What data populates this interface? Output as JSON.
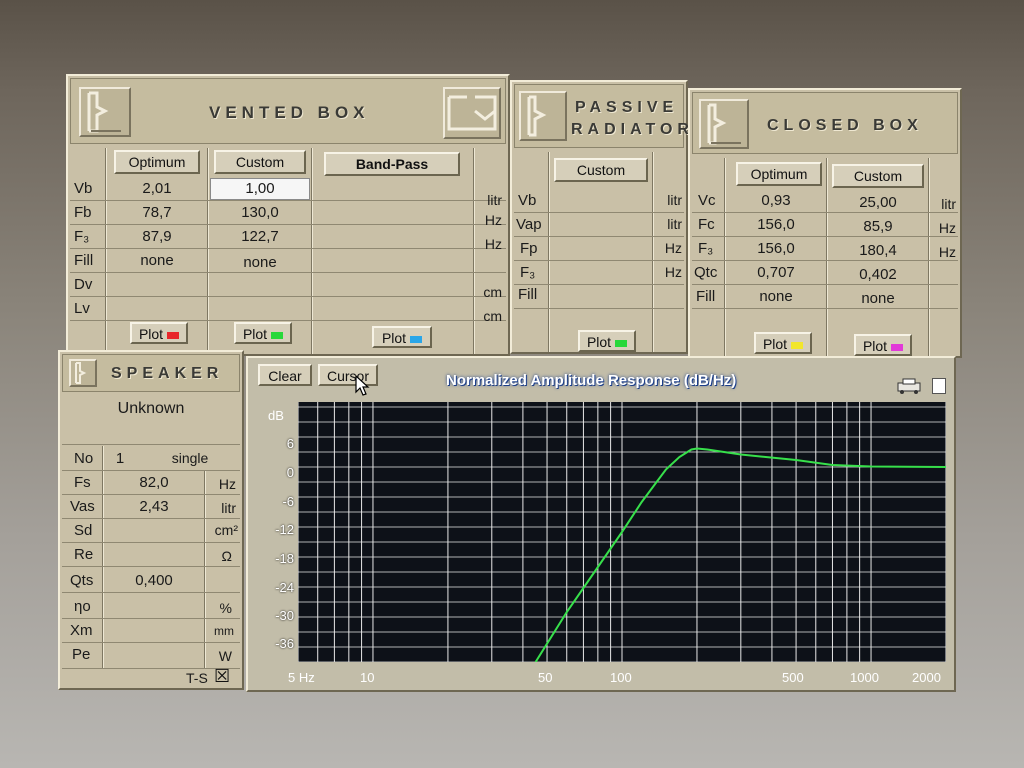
{
  "vented_box": {
    "title": "VENTED BOX",
    "cols": {
      "optimum": "Optimum",
      "custom": "Custom",
      "bandpass": "Band-Pass"
    },
    "rows": [
      {
        "label": "Vb",
        "optimum": "2,01",
        "custom": "1,00",
        "unit": "litr"
      },
      {
        "label": "Fb",
        "optimum": "78,7",
        "custom": "130,0",
        "unit": "Hz"
      },
      {
        "label": "F₃",
        "optimum": "87,9",
        "custom": "122,7",
        "unit": "Hz"
      },
      {
        "label": "Fill",
        "optimum": "none",
        "custom": "none",
        "unit": ""
      },
      {
        "label": "Dv",
        "optimum": "",
        "custom": "",
        "unit": "cm"
      },
      {
        "label": "Lv",
        "optimum": "",
        "custom": "",
        "unit": "cm"
      }
    ],
    "plot_label": "Plot",
    "plot_colors": {
      "optimum": "#e8272b",
      "custom": "#27d83a",
      "bandpass": "#2aa6e8"
    }
  },
  "passive_radiator": {
    "title_line1": "PASSIVE",
    "title_line2": "RADIATOR",
    "custom_label": "Custom",
    "rows": [
      {
        "label": "Vb",
        "unit": "litr"
      },
      {
        "label": "Vap",
        "unit": "litr"
      },
      {
        "label": "Fp",
        "unit": "Hz"
      },
      {
        "label": "F₃",
        "unit": "Hz"
      },
      {
        "label": "Fill",
        "unit": ""
      }
    ],
    "plot_label": "Plot",
    "plot_color": "#27d83a"
  },
  "closed_box": {
    "title": "CLOSED BOX",
    "cols": {
      "optimum": "Optimum",
      "custom": "Custom"
    },
    "rows": [
      {
        "label": "Vc",
        "optimum": "0,93",
        "custom": "25,00",
        "unit": "litr"
      },
      {
        "label": "Fc",
        "optimum": "156,0",
        "custom": "85,9",
        "unit": "Hz"
      },
      {
        "label": "F₃",
        "optimum": "156,0",
        "custom": "180,4",
        "unit": "Hz"
      },
      {
        "label": "Qtc",
        "optimum": "0,707",
        "custom": "0,402",
        "unit": ""
      },
      {
        "label": "Fill",
        "optimum": "none",
        "custom": "none",
        "unit": ""
      }
    ],
    "plot_label": "Plot",
    "plot_colors": {
      "optimum": "#f2e62a",
      "custom": "#e23ad8"
    }
  },
  "speaker": {
    "title": "SPEAKER",
    "name": "Unknown",
    "no_label": "No",
    "no_value": "1",
    "no_mode": "single",
    "rows": [
      {
        "label": "Fs",
        "value": "82,0",
        "unit": "Hz"
      },
      {
        "label": "Vas",
        "value": "2,43",
        "unit": "litr"
      },
      {
        "label": "Sd",
        "value": "",
        "unit": "cm²"
      },
      {
        "label": "Re",
        "value": "",
        "unit": "Ω"
      },
      {
        "label": "Qts",
        "value": "0,400",
        "unit": ""
      },
      {
        "label": "ηo",
        "value": "",
        "unit": "%"
      },
      {
        "label": "Xm",
        "value": "",
        "unit": "mm"
      },
      {
        "label": "Pe",
        "value": "",
        "unit": "W"
      }
    ],
    "ts_label": "T-S",
    "ts_checked": "☒"
  },
  "plot_window": {
    "clear_label": "Clear",
    "cursor_label": "Cursor",
    "title": "Normalized Amplitude Response (dB/Hz)",
    "y_unit": "dB",
    "y_ticks": [
      "6",
      "0",
      "-6",
      "-12",
      "-18",
      "-24",
      "-30",
      "-36"
    ],
    "x_ticks": [
      "5 Hz",
      "10",
      "50",
      "100",
      "500",
      "1000",
      "2000"
    ],
    "curve_color": "#37e04b"
  },
  "chart_data": {
    "type": "line",
    "title": "Normalized Amplitude Response (dB/Hz)",
    "xlabel": "",
    "ylabel": "dB",
    "x_scale": "log",
    "xlim": [
      5,
      2000
    ],
    "ylim": [
      -40,
      12
    ],
    "grid": true,
    "series": [
      {
        "x": [
          45,
          60,
          80,
          100,
          120,
          150,
          170,
          190,
          200,
          220,
          300,
          500,
          700,
          1000,
          2000
        ],
        "y": [
          -40,
          -30,
          -21,
          -14,
          -8,
          -1.5,
          1,
          2.5,
          2.7,
          2.5,
          1.5,
          0.4,
          -0.6,
          -0.9,
          -1.0
        ]
      }
    ]
  }
}
